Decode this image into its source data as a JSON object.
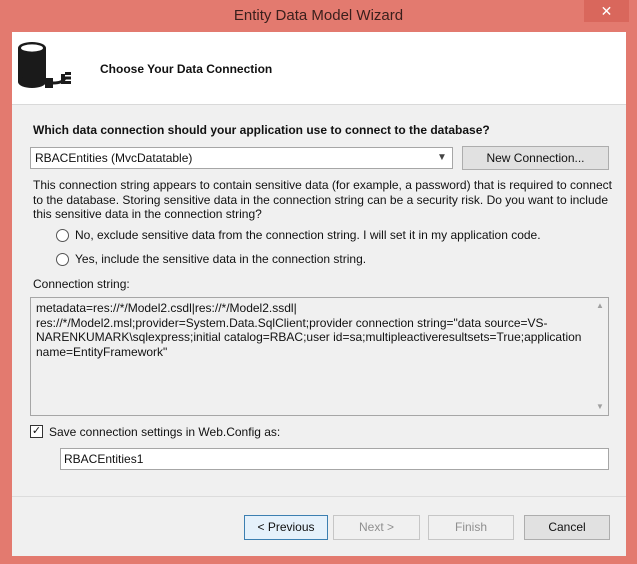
{
  "window": {
    "title": "Entity Data Model Wizard",
    "close_glyph": "✕"
  },
  "header": {
    "title": "Choose Your Data Connection",
    "icon": "database-plug-icon"
  },
  "connection": {
    "question": "Which data connection should your application use to connect to the database?",
    "selected_connection": "RBACEntities (MvcDatatable)",
    "new_connection_label": "New Connection...",
    "sensitive_info": "This connection string appears to contain sensitive data (for example, a password) that is required to connect to the database. Storing sensitive data in the connection string can be a security risk. Do you want to include this sensitive data in the connection string?",
    "option_exclude": "No, exclude sensitive data from the connection string. I will set it in my application code.",
    "option_include": "Yes, include the sensitive data in the connection string.",
    "string_label": "Connection string:",
    "string_value_lines": [
      "metadata=res://*/Model2.csdl|res://*/Model2.ssdl|",
      "res://*/Model2.msl;provider=System.Data.SqlClient;provider connection string=\"data source=VS-",
      "NARENKUMARK\\sqlexpress;initial catalog=RBAC;user id=sa;multipleactiveresultsets=True;application",
      "name=EntityFramework\""
    ]
  },
  "save_settings": {
    "checked": true,
    "check_glyph": "✓",
    "label": "Save connection settings in Web.Config as:",
    "name_value": "RBACEntities1"
  },
  "footer": {
    "previous_label": "< Previous",
    "next_label": "Next >",
    "finish_label": "Finish",
    "cancel_label": "Cancel"
  },
  "colors": {
    "titlebar": "#e37a6f",
    "panel": "#f0f0f0",
    "focus_border": "#3c7fb1"
  }
}
